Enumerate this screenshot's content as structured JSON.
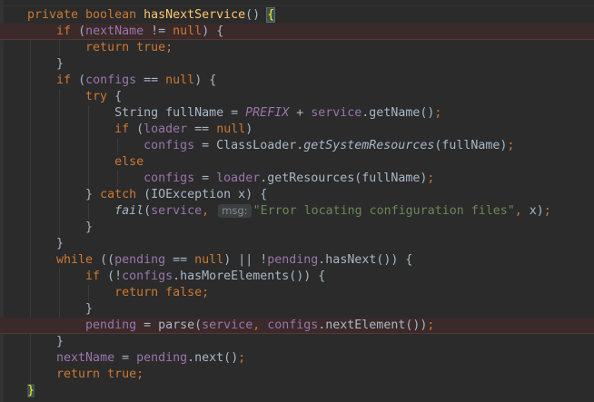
{
  "code_lines": [
    [
      {
        "t": "private ",
        "c": "kw"
      },
      {
        "t": "boolean ",
        "c": "kw"
      },
      {
        "t": "hasNextService",
        "c": "fn"
      },
      {
        "t": "() "
      },
      {
        "t": "{",
        "c": "brace-match"
      }
    ],
    [
      {
        "t": "    "
      },
      {
        "t": "if ",
        "c": "kw"
      },
      {
        "t": "("
      },
      {
        "t": "nextName",
        "c": "fld"
      },
      {
        "t": " != "
      },
      {
        "t": "null",
        "c": "kw"
      },
      {
        "t": ") {"
      }
    ],
    [
      {
        "t": "        "
      },
      {
        "t": "return ",
        "c": "kw"
      },
      {
        "t": "true",
        "c": "kw"
      },
      {
        "t": ";",
        "c": "punc"
      }
    ],
    [
      {
        "t": "    }"
      }
    ],
    [
      {
        "t": "    "
      },
      {
        "t": "if ",
        "c": "kw"
      },
      {
        "t": "("
      },
      {
        "t": "configs",
        "c": "fld"
      },
      {
        "t": " == "
      },
      {
        "t": "null",
        "c": "kw"
      },
      {
        "t": ") {"
      }
    ],
    [
      {
        "t": "        "
      },
      {
        "t": "try ",
        "c": "kw"
      },
      {
        "t": "{"
      }
    ],
    [
      {
        "t": "            String fullName = "
      },
      {
        "t": "PREFIX",
        "c": "const"
      },
      {
        "t": " + "
      },
      {
        "t": "service",
        "c": "fld"
      },
      {
        "t": ".getName()"
      },
      {
        "t": ";",
        "c": "punc"
      }
    ],
    [
      {
        "t": "            "
      },
      {
        "t": "if ",
        "c": "kw"
      },
      {
        "t": "("
      },
      {
        "t": "loader",
        "c": "fld"
      },
      {
        "t": " == "
      },
      {
        "t": "null",
        "c": "kw"
      },
      {
        "t": ")"
      }
    ],
    [
      {
        "t": "                "
      },
      {
        "t": "configs",
        "c": "fld"
      },
      {
        "t": " = ClassLoader."
      },
      {
        "t": "getSystemResources",
        "c": "ital"
      },
      {
        "t": "(fullName)"
      },
      {
        "t": ";",
        "c": "punc"
      }
    ],
    [
      {
        "t": "            "
      },
      {
        "t": "else",
        "c": "kw"
      }
    ],
    [
      {
        "t": "                "
      },
      {
        "t": "configs",
        "c": "fld"
      },
      {
        "t": " = "
      },
      {
        "t": "loader",
        "c": "fld"
      },
      {
        "t": ".getResources(fullName)"
      },
      {
        "t": ";",
        "c": "punc"
      }
    ],
    [
      {
        "t": "        } "
      },
      {
        "t": "catch ",
        "c": "kw"
      },
      {
        "t": "(IOException x) {"
      }
    ],
    [
      {
        "t": "            "
      },
      {
        "t": "fail",
        "c": "ital"
      },
      {
        "t": "("
      },
      {
        "t": "service",
        "c": "fld"
      },
      {
        "t": ", ",
        "c": "punc"
      },
      {
        "t": "msg:",
        "c": "hint"
      },
      {
        "t": "\"Error locating configuration files\"",
        "c": "str"
      },
      {
        "t": ", ",
        "c": "punc"
      },
      {
        "t": "x)"
      },
      {
        "t": ";",
        "c": "punc"
      }
    ],
    [
      {
        "t": "        }"
      }
    ],
    [
      {
        "t": "    }"
      }
    ],
    [
      {
        "t": "    "
      },
      {
        "t": "while ",
        "c": "kw"
      },
      {
        "t": "(("
      },
      {
        "t": "pending",
        "c": "fld"
      },
      {
        "t": " == "
      },
      {
        "t": "null",
        "c": "kw"
      },
      {
        "t": ") || !"
      },
      {
        "t": "pending",
        "c": "fld"
      },
      {
        "t": ".hasNext()) {"
      }
    ],
    [
      {
        "t": "        "
      },
      {
        "t": "if ",
        "c": "kw"
      },
      {
        "t": "(!"
      },
      {
        "t": "configs",
        "c": "fld"
      },
      {
        "t": ".hasMoreElements()) {"
      }
    ],
    [
      {
        "t": "            "
      },
      {
        "t": "return ",
        "c": "kw"
      },
      {
        "t": "false",
        "c": "kw"
      },
      {
        "t": ";",
        "c": "punc"
      }
    ],
    [
      {
        "t": "        }"
      }
    ],
    [
      {
        "t": "        "
      },
      {
        "t": "pending",
        "c": "fld"
      },
      {
        "t": " = parse("
      },
      {
        "t": "service",
        "c": "fld"
      },
      {
        "t": ", ",
        "c": "punc"
      },
      {
        "t": "configs",
        "c": "fld"
      },
      {
        "t": ".nextElement())"
      },
      {
        "t": ";",
        "c": "punc"
      }
    ],
    [
      {
        "t": "    }"
      }
    ],
    [
      {
        "t": "    "
      },
      {
        "t": "nextName",
        "c": "fld"
      },
      {
        "t": " = "
      },
      {
        "t": "pending",
        "c": "fld"
      },
      {
        "t": ".next()"
      },
      {
        "t": ";",
        "c": "punc"
      }
    ],
    [
      {
        "t": "    "
      },
      {
        "t": "return ",
        "c": "kw"
      },
      {
        "t": "true",
        "c": "kw"
      },
      {
        "t": ";",
        "c": "punc"
      }
    ],
    [
      {
        "t": "}",
        "c": "brace-end"
      }
    ]
  ],
  "highlighted_lines": [
    1,
    19
  ],
  "colors": {
    "background": "#2b2b2b",
    "keyword": "#cc7832",
    "method_declaration": "#ffc66d",
    "field": "#9876aa",
    "string": "#6a8759",
    "default_text": "#a9b7c6",
    "highlight_line": "#3a2a2a"
  }
}
